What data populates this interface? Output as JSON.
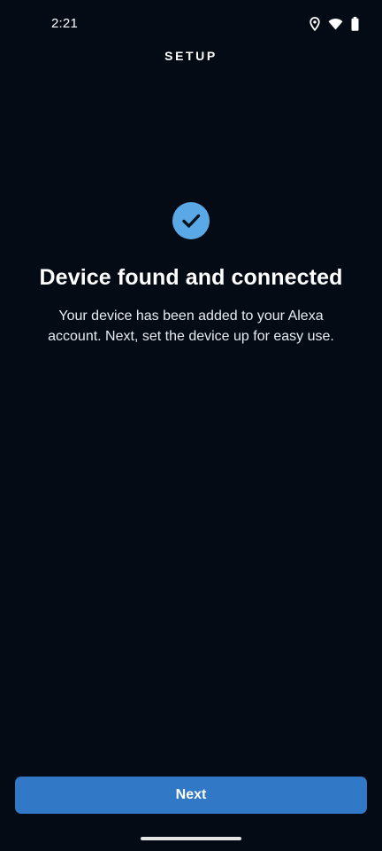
{
  "status_bar": {
    "time": "2:21",
    "icons": [
      "location-icon",
      "wifi-icon",
      "battery-icon"
    ]
  },
  "header": {
    "title": "SETUP"
  },
  "main": {
    "status_icon": "checkmark-circle-icon",
    "headline": "Device found and connected",
    "body": "Your device has been added to your Alexa account. Next, set the device up for easy use."
  },
  "footer": {
    "next_label": "Next"
  },
  "colors": {
    "background": "#040b15",
    "accent": "#3178c6",
    "check_badge": "#5aa9e6"
  }
}
